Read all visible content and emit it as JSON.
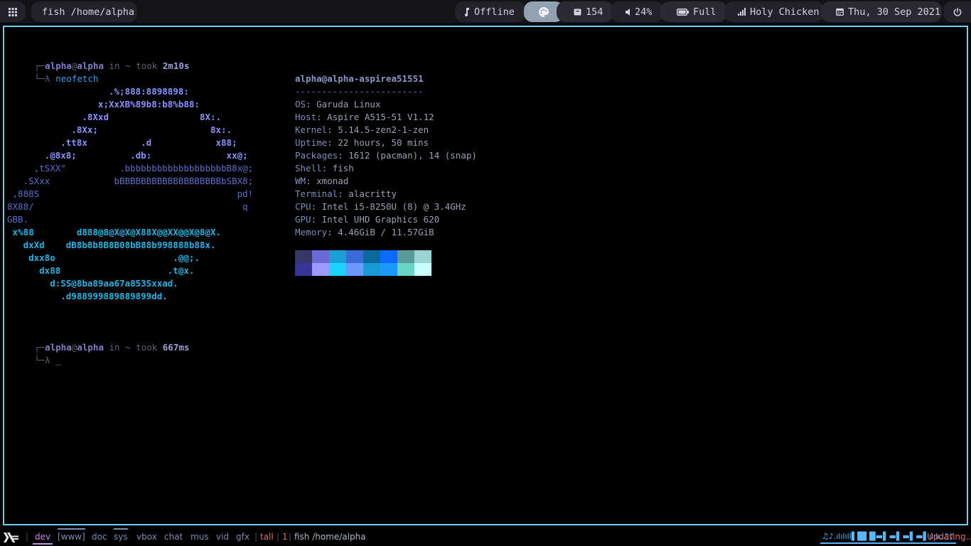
{
  "topbar": {
    "window_title": "fish /home/alpha",
    "music": "Offline",
    "updates": "154",
    "volume": "24%",
    "battery": "Full",
    "network": "Holy Chicken",
    "date": "Thu, 30 Sep 2021"
  },
  "terminal": {
    "prompt1": {
      "corner": "┌─",
      "user": "alpha",
      "at": "@",
      "host": "alpha",
      "in": " in ",
      "dir": "~",
      "took": " took ",
      "time": "2m10s"
    },
    "cmd1": {
      "lambda": "└─λ ",
      "command": "neofetch"
    },
    "art": [
      {
        "text": "                   .%;888:8898898:",
        "cls": "art1"
      },
      {
        "text": "                 x;XxXB%89b8:b8%b88:",
        "cls": "art1"
      },
      {
        "text": "              .8Xxd                 8X:.",
        "cls": "art1"
      },
      {
        "text": "            .8Xx;                     8x:.",
        "cls": "art1"
      },
      {
        "text": "          .tt8x          .d            x88;",
        "cls": "art1"
      },
      {
        "text": "       .@8x8;          .db:              xx@;",
        "cls": "art1"
      },
      {
        "text": "     ,tSXX°          .bbbbbbbbbbbbbbbbbbbB8x@;",
        "cls": "art2"
      },
      {
        "text": "   .SXxx            bBBBBBBBBBBBBBBBBBBBbSBX8;",
        "cls": "art2"
      },
      {
        "text": " ,888S                                     pd!",
        "cls": "art2"
      },
      {
        "text": "8X88/                                       q",
        "cls": "art2"
      },
      {
        "text": "GBB.",
        "cls": "art2"
      },
      {
        "text": " x%88        d888@8@X@X@X88X@@XX@@X@8@X.",
        "cls": "art3"
      },
      {
        "text": "   dxXd    dB8b8b8B8B08bB88b998888b88x.",
        "cls": "art3"
      },
      {
        "text": "    dxx8o                      .@@;.",
        "cls": "art3"
      },
      {
        "text": "      dx88                    .t@x.",
        "cls": "art3"
      },
      {
        "text": "        d:SS@8ba89aa67a853Sxxad.",
        "cls": "art3"
      },
      {
        "text": "          .d988999889889899dd.",
        "cls": "art3"
      }
    ],
    "info": {
      "title": "alpha@alpha-aspirea51551",
      "rule": "------------------------",
      "rows": [
        {
          "k": "OS",
          "v": "Garuda Linux"
        },
        {
          "k": "Host",
          "v": "Aspire A515-51 V1.12"
        },
        {
          "k": "Kernel",
          "v": "5.14.5-zen2-1-zen"
        },
        {
          "k": "Uptime",
          "v": "22 hours, 50 mins"
        },
        {
          "k": "Packages",
          "v": "1612 (pacman), 14 (snap)"
        },
        {
          "k": "Shell",
          "v": "fish"
        },
        {
          "k": "WM",
          "v": "xmonad"
        },
        {
          "k": "Terminal",
          "v": "alacritty"
        },
        {
          "k": "CPU",
          "v": "Intel i5-8250U (8) @ 3.4GHz"
        },
        {
          "k": "GPU",
          "v": "Intel UHD Graphics 620"
        },
        {
          "k": "Memory",
          "v": "4.46GiB / 11.57GiB"
        }
      ],
      "colon": ": "
    },
    "palette": {
      "row1": [
        "#353568",
        "#6a6ad8",
        "#1aa0d4",
        "#3a6ad8",
        "#0a6aa0",
        "#0a6aff",
        "#5a9a9a",
        "#9ad4d4"
      ],
      "row2": [
        "#35359a",
        "#9a9aff",
        "#1ad4ff",
        "#6a9aff",
        "#1a9ad4",
        "#1a9aff",
        "#6ad4c8",
        "#c8ffff"
      ]
    },
    "prompt2": {
      "corner": "┌─",
      "user": "alpha",
      "at": "@",
      "host": "alpha",
      "in": " in ",
      "dir": "~",
      "took": " took ",
      "time": "667ms"
    },
    "cmd2": {
      "lambda": "└─λ ",
      "cursor": "_"
    }
  },
  "bottombar": {
    "workspaces": [
      "dev",
      "[www]",
      "doc",
      "sys",
      "vbox",
      "chat",
      "mus",
      "vid",
      "gfx"
    ],
    "sep": "|",
    "layout": "tall",
    "windows": "1",
    "title": "fish /home/alpha",
    "visualizer": "♫♪.ılılıll▌█▌█▬▌▬▌▬▌▬▌ılılı.♫♪",
    "status": "Updating..."
  }
}
